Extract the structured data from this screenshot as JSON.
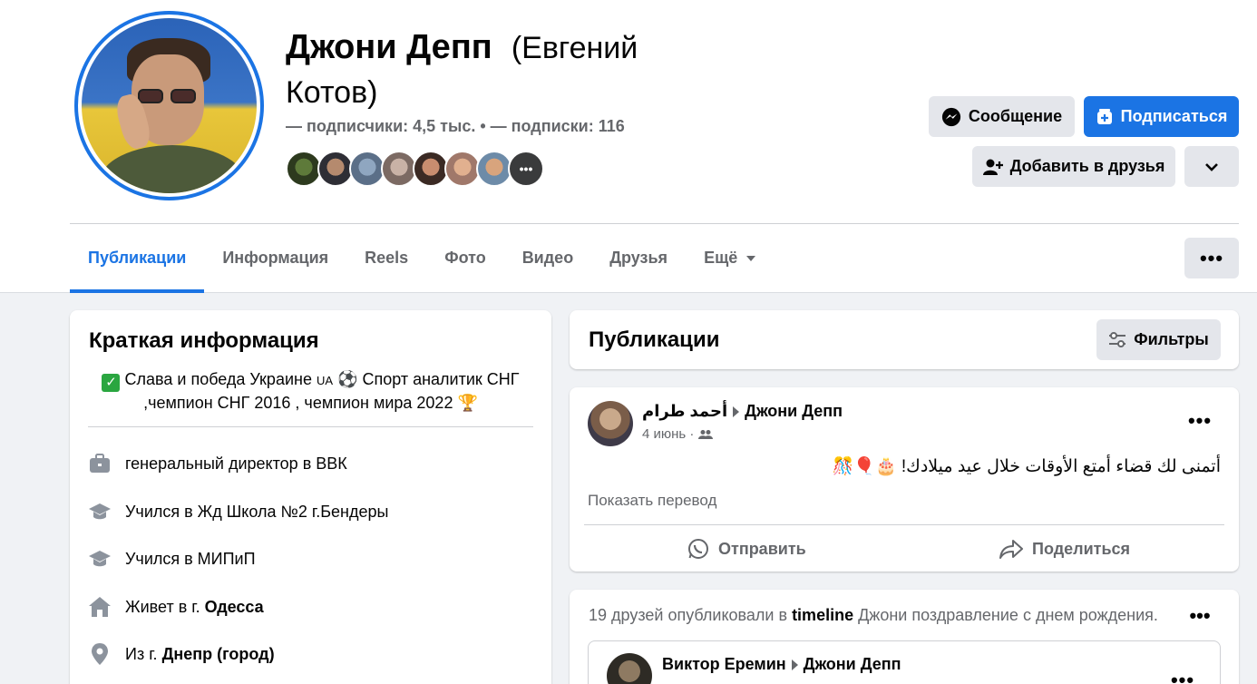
{
  "profile": {
    "name": "Джони Депп",
    "alt_name": "(Евгений Котов)",
    "followers_text": "— подписчики: 4,5 тыс. • — подписки: 116"
  },
  "actions": {
    "message_label": "Сообщение",
    "subscribe_label": "Подписаться",
    "add_friend_label": "Добавить в друзья"
  },
  "tabs": [
    {
      "label": "Публикации"
    },
    {
      "label": "Информация"
    },
    {
      "label": "Reels"
    },
    {
      "label": "Фото"
    },
    {
      "label": "Видео"
    },
    {
      "label": "Друзья"
    },
    {
      "label": "Ещё"
    }
  ],
  "intro": {
    "title": "Краткая информация",
    "bio_line1": "Слава и победа Украине ",
    "bio_flag": "UA",
    "bio_line1b": " ⚽ Спорт аналитик СНГ",
    "bio_line2": ",чемпион СНГ 2016 , чемпион мира 2022 🏆",
    "items": [
      {
        "text": "генеральный директор в ВВК",
        "bold": "",
        "icon": "briefcase-icon"
      },
      {
        "text": "Учился в Жд Школа №2 г.Бендеры",
        "bold": "",
        "icon": "graduation-cap-icon"
      },
      {
        "text": "Учился в МИПиП",
        "bold": "",
        "icon": "graduation-cap-icon"
      },
      {
        "text": "Живет в г.",
        "bold": "Одесса",
        "icon": "home-icon"
      },
      {
        "text": "Из г.",
        "bold": "Днепр (город)",
        "icon": "location-pin-icon"
      }
    ]
  },
  "publications": {
    "title": "Публикации",
    "filters_label": "Фильтры"
  },
  "post1": {
    "author": "أحمد طرام",
    "target": "Джони Депп",
    "date": "4 июнь",
    "text": "أتمنى لك قضاء أمتع الأوقات خلال عيد ميلادك! 🎂🎈🎊",
    "translate_label": "Показать перевод",
    "send_label": "Отправить",
    "share_label": "Поделиться"
  },
  "post2": {
    "prefix": "19 друзей опубликовали в ",
    "bold": "timeline",
    "suffix": " Джони поздравление с днем рождения.",
    "inner_author": "Виктор Еремин",
    "inner_target": "Джони Депп"
  },
  "colors": {
    "accent": "#1b74e4",
    "background": "#f0f2f5",
    "muted_text": "#65676b"
  }
}
